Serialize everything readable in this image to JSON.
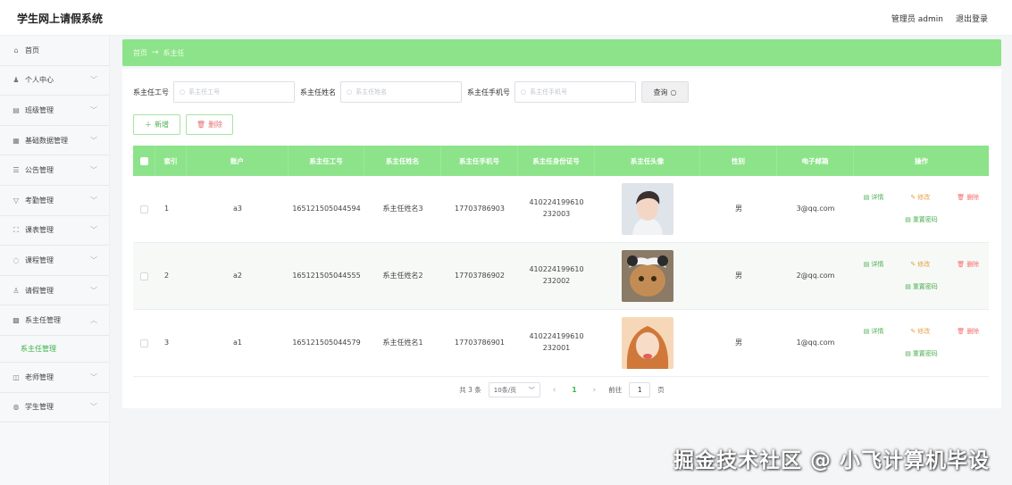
{
  "header": {
    "title": "学生网上请假系统",
    "user": "管理员 admin",
    "logout": "退出登录"
  },
  "sidebar": {
    "items": [
      {
        "label": "首页",
        "icon": "⌂"
      },
      {
        "label": "个人中心",
        "icon": "♟"
      },
      {
        "label": "班级管理",
        "icon": "▤"
      },
      {
        "label": "基础数据管理",
        "icon": "▦"
      },
      {
        "label": "公告管理",
        "icon": "☰"
      },
      {
        "label": "考勤管理",
        "icon": "▽"
      },
      {
        "label": "课表管理",
        "icon": "⛶"
      },
      {
        "label": "课程管理",
        "icon": "◌"
      },
      {
        "label": "请假管理",
        "icon": "♙"
      },
      {
        "label": "系主任管理",
        "icon": "▩"
      },
      {
        "label": "老师管理",
        "icon": "◫"
      },
      {
        "label": "学生管理",
        "icon": "◍"
      }
    ],
    "active_sub": "系主任管理"
  },
  "breadcrumb": {
    "home": "首页",
    "arrow": "→",
    "current": "系主任"
  },
  "search": {
    "f1": {
      "label": "系主任工号",
      "placeholder": "系主任工号"
    },
    "f2": {
      "label": "系主任姓名",
      "placeholder": "系主任姓名"
    },
    "f3": {
      "label": "系主任手机号",
      "placeholder": "系主任手机号"
    },
    "button": "查询"
  },
  "actions": {
    "add": "新增",
    "del": "删除"
  },
  "table": {
    "headers": [
      "索引",
      "账户",
      "系主任工号",
      "系主任姓名",
      "系主任手机号",
      "系主任身份证号",
      "系主任头像",
      "性别",
      "电子邮箱",
      "操作"
    ],
    "rows": [
      {
        "idx": "1",
        "account": "a3",
        "job": "165121505044594",
        "name": "系主任姓名3",
        "phone": "17703786903",
        "idcard": "410224199610232003",
        "gender": "男",
        "email": "3@qq.com"
      },
      {
        "idx": "2",
        "account": "a2",
        "job": "165121505044555",
        "name": "系主任姓名2",
        "phone": "17703786902",
        "idcard": "410224199610232002",
        "gender": "男",
        "email": "2@qq.com"
      },
      {
        "idx": "3",
        "account": "a1",
        "job": "165121505044579",
        "name": "系主任姓名1",
        "phone": "17703786901",
        "idcard": "410224199610232001",
        "gender": "男",
        "email": "1@qq.com"
      }
    ],
    "ops": {
      "detail": "详情",
      "edit": "修改",
      "del": "删除",
      "reset": "重置密码"
    }
  },
  "pager": {
    "total": "共 3 条",
    "size": "10条/页",
    "page": "1",
    "goto": "前往",
    "goto_value": "1",
    "unit": "页"
  },
  "watermark": "掘金技术社区 @ 小飞计算机毕设"
}
